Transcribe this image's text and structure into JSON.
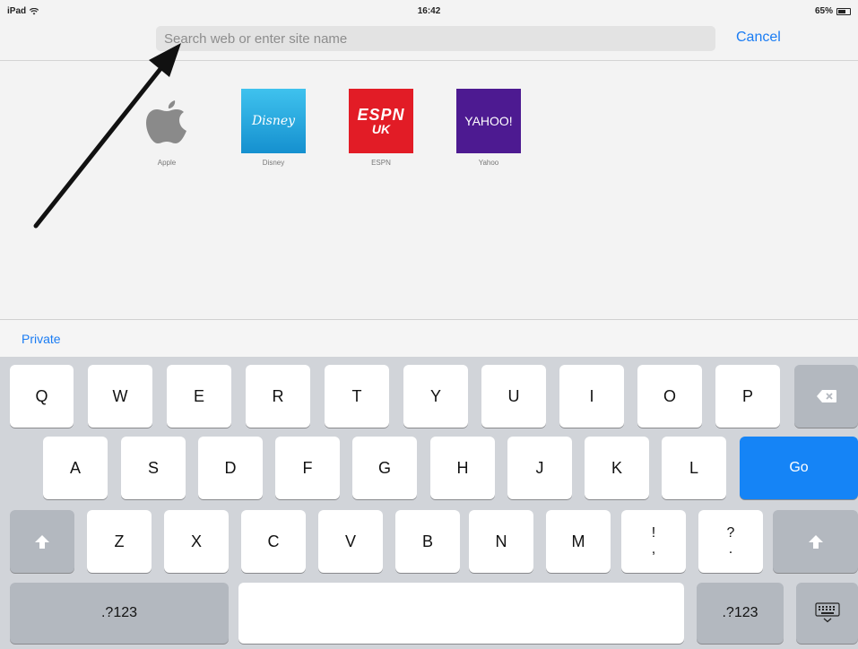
{
  "status_bar": {
    "device": "iPad",
    "time": "16:42",
    "battery": "65%",
    "battery_level": 0.65
  },
  "url_bar": {
    "placeholder": "Search web or enter site name",
    "cancel_label": "Cancel"
  },
  "favorites": [
    {
      "name": "Apple",
      "tile_text": ""
    },
    {
      "name": "Disney",
      "tile_text": "Disney"
    },
    {
      "name": "ESPN",
      "tile_text": "ESPN",
      "tile_text_2": "UK"
    },
    {
      "name": "Yahoo",
      "tile_text": "YAHOO!"
    }
  ],
  "private_label": "Private",
  "keyboard": {
    "row1": [
      "Q",
      "W",
      "E",
      "R",
      "T",
      "Y",
      "U",
      "I",
      "O",
      "P"
    ],
    "row2": [
      "A",
      "S",
      "D",
      "F",
      "G",
      "H",
      "J",
      "K",
      "L"
    ],
    "row3": [
      "Z",
      "X",
      "C",
      "V",
      "B",
      "N",
      "M"
    ],
    "exclaim": {
      "top": "!",
      "bottom": ","
    },
    "question": {
      "top": "?",
      "bottom": "."
    },
    "go_label": "Go",
    "numbers_label": ".?123"
  },
  "colors": {
    "accent": "#1a7cf3",
    "go_key": "#1584f6",
    "espn": "#e21c26",
    "yahoo": "#4d1a91",
    "disney": "#1fa7e1"
  },
  "icons": [
    "wifi-icon",
    "battery-icon",
    "apple-logo",
    "backspace-icon",
    "shift-icon",
    "keyboard-dismiss-icon",
    "annotation-arrow"
  ]
}
